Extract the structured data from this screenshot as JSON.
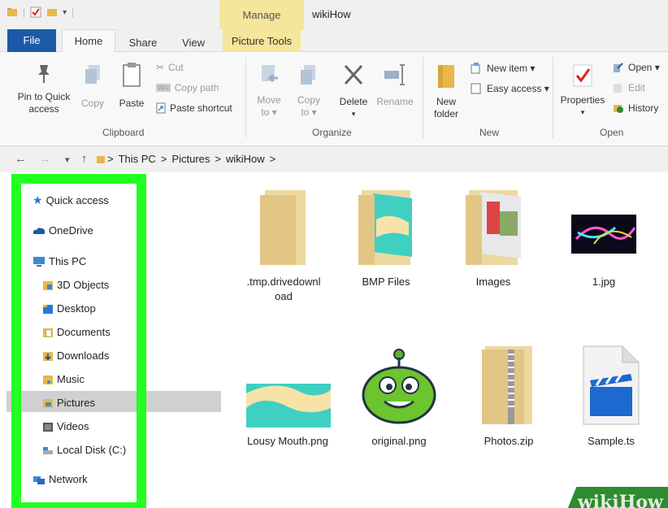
{
  "window": {
    "title": "wikiHow",
    "context_tab": "Manage"
  },
  "tabs": {
    "file": "File",
    "home": "Home",
    "share": "Share",
    "view": "View",
    "picture_tools": "Picture Tools"
  },
  "ribbon": {
    "clipboard": {
      "pin": "Pin to Quick access",
      "copy": "Copy",
      "paste": "Paste",
      "cut": "Cut",
      "copy_path": "Copy path",
      "paste_shortcut": "Paste shortcut",
      "label": "Clipboard"
    },
    "organize": {
      "move_to": "Move to ▾",
      "copy_to": "Copy to ▾",
      "delete": "Delete",
      "rename": "Rename",
      "label": "Organize"
    },
    "new": {
      "new_folder": "New folder",
      "new_item": "New item ▾",
      "easy_access": "Easy access ▾",
      "label": "New"
    },
    "open": {
      "properties": "Properties",
      "open": "Open ▾",
      "edit": "Edit",
      "history": "History",
      "label": "Open"
    }
  },
  "address": {
    "crumbs": [
      "This PC",
      "Pictures",
      "wikiHow"
    ],
    "sep": ">"
  },
  "sidebar": {
    "items": [
      {
        "label": "Quick access",
        "icon": "star-icon"
      },
      {
        "label": "OneDrive",
        "icon": "cloud-icon"
      },
      {
        "label": "This PC",
        "icon": "computer-icon"
      },
      {
        "label": "3D Objects",
        "icon": "cube-folder-icon"
      },
      {
        "label": "Desktop",
        "icon": "desktop-folder-icon"
      },
      {
        "label": "Documents",
        "icon": "documents-folder-icon"
      },
      {
        "label": "Downloads",
        "icon": "downloads-folder-icon"
      },
      {
        "label": "Music",
        "icon": "music-folder-icon"
      },
      {
        "label": "Pictures",
        "icon": "pictures-folder-icon",
        "selected": true
      },
      {
        "label": "Videos",
        "icon": "videos-folder-icon"
      },
      {
        "label": "Local Disk (C:)",
        "icon": "drive-icon"
      },
      {
        "label": "Network",
        "icon": "network-icon"
      }
    ]
  },
  "files": [
    {
      "name": ".tmp.drivedownl\noad",
      "type": "folder"
    },
    {
      "name": "BMP Files",
      "type": "folder-pictures"
    },
    {
      "name": "Images",
      "type": "folder-images"
    },
    {
      "name": "1.jpg",
      "type": "image"
    },
    {
      "name": "Lousy Mouth.png",
      "type": "image"
    },
    {
      "name": "original.png",
      "type": "image"
    },
    {
      "name": "Photos.zip",
      "type": "zip"
    },
    {
      "name": "Sample.ts",
      "type": "video"
    }
  ],
  "watermark": "wikiHow",
  "colors": {
    "file_tab": "#1c5aa8",
    "manage_tab": "#f4e69a",
    "highlight_frame": "#22ff22",
    "watermark_bg": "#2e8b2e"
  }
}
